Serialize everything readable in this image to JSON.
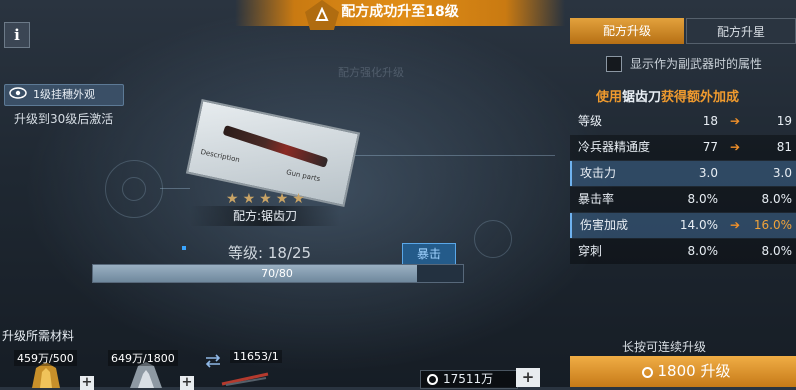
{
  "banner": {
    "title": "配方成功升至18级"
  },
  "info_button": "i",
  "pendant": {
    "label": "1级挂穗外观",
    "hint": "升级到30级后激活"
  },
  "background_text": "配方强化升级",
  "item": {
    "card_desc": "Description",
    "card_gun_parts": "Gun parts",
    "stars": 5,
    "name": "配方:锯齿刀",
    "level_label": "等级:",
    "level_current": "18",
    "level_max": "25",
    "crit_label": "暴击",
    "xp_text": "70/80",
    "xp_fraction": 0.875
  },
  "materials": {
    "title": "升级所需材料",
    "slots": [
      {
        "count": "459万/500",
        "icon": "gold-emblem-icon"
      },
      {
        "count": "649万/1800",
        "icon": "silver-emblem-icon"
      },
      {
        "count": "11653/1",
        "icon": "swap-icon"
      }
    ],
    "plus": "+",
    "coins": "17511万",
    "coin_plus": "+"
  },
  "tabs": [
    {
      "label": "配方升级",
      "active": true
    },
    {
      "label": "配方升星",
      "active": false
    }
  ],
  "secondary_checkbox": {
    "label": "显示作为副武器时的属性",
    "checked": false
  },
  "bonus_title": {
    "prefix": "使用",
    "weapon": "锯齿刀",
    "suffix": "获得额外加成"
  },
  "stats": [
    {
      "name": "等级",
      "from": "18",
      "to": "19",
      "arrow": true,
      "up": false,
      "style": "plain"
    },
    {
      "name": "冷兵器精通度",
      "from": "77",
      "to": "81",
      "arrow": true,
      "up": false,
      "style": "alt"
    },
    {
      "name": "攻击力",
      "from": "3.0",
      "to": "3.0",
      "arrow": false,
      "up": false,
      "style": "hl"
    },
    {
      "name": "暴击率",
      "from": "8.0%",
      "to": "8.0%",
      "arrow": false,
      "up": false,
      "style": "alt"
    },
    {
      "name": "伤害加成",
      "from": "14.0%",
      "to": "16.0%",
      "arrow": true,
      "up": true,
      "style": "hl"
    },
    {
      "name": "穿刺",
      "from": "8.0%",
      "to": "8.0%",
      "arrow": false,
      "up": false,
      "style": "alt"
    }
  ],
  "hold_hint": "长按可连续升级",
  "upgrade_button": {
    "cost": "1800",
    "label": "升级"
  },
  "colors": {
    "accent": "#e08d16",
    "highlight_row": "#3c648c",
    "arrow": "#f0902a"
  }
}
